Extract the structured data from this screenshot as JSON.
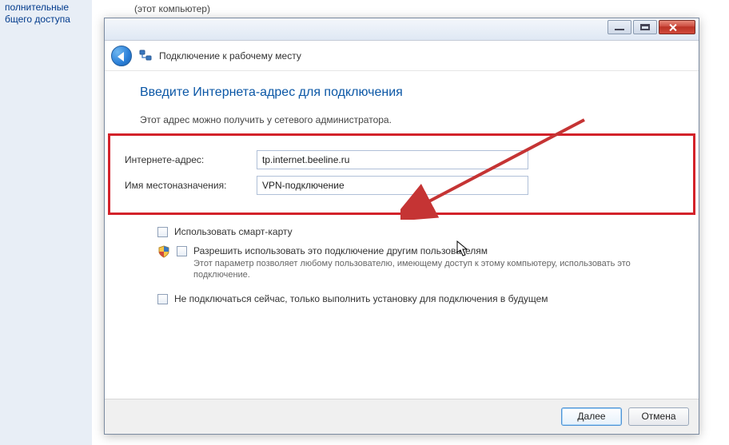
{
  "background": {
    "left_fragment_line1": "полнительные",
    "left_fragment_line2": "бщего доступа",
    "top_fragment": "(этот компьютер)"
  },
  "window": {
    "header_title": "Подключение к рабочему месту",
    "heading": "Введите Интернета-адрес для подключения",
    "subtext": "Этот адрес можно получить у сетевого администратора.",
    "field_internet_label": "Интернете-адрес:",
    "field_internet_value": "tp.internet.beeline.ru",
    "field_destination_label": "Имя местоназначения:",
    "field_destination_value": "VPN-подключение",
    "option_smartcard": "Использовать смарт-карту",
    "option_share": "Разрешить использовать это подключение другим пользователям",
    "option_share_desc": "Этот параметр позволяет любому пользователю, имеющему доступ к этому компьютеру, использовать это подключение.",
    "option_nodial": "Не подключаться сейчас, только выполнить установку для подключения в будущем",
    "btn_next": "Далее",
    "btn_cancel": "Отмена"
  }
}
